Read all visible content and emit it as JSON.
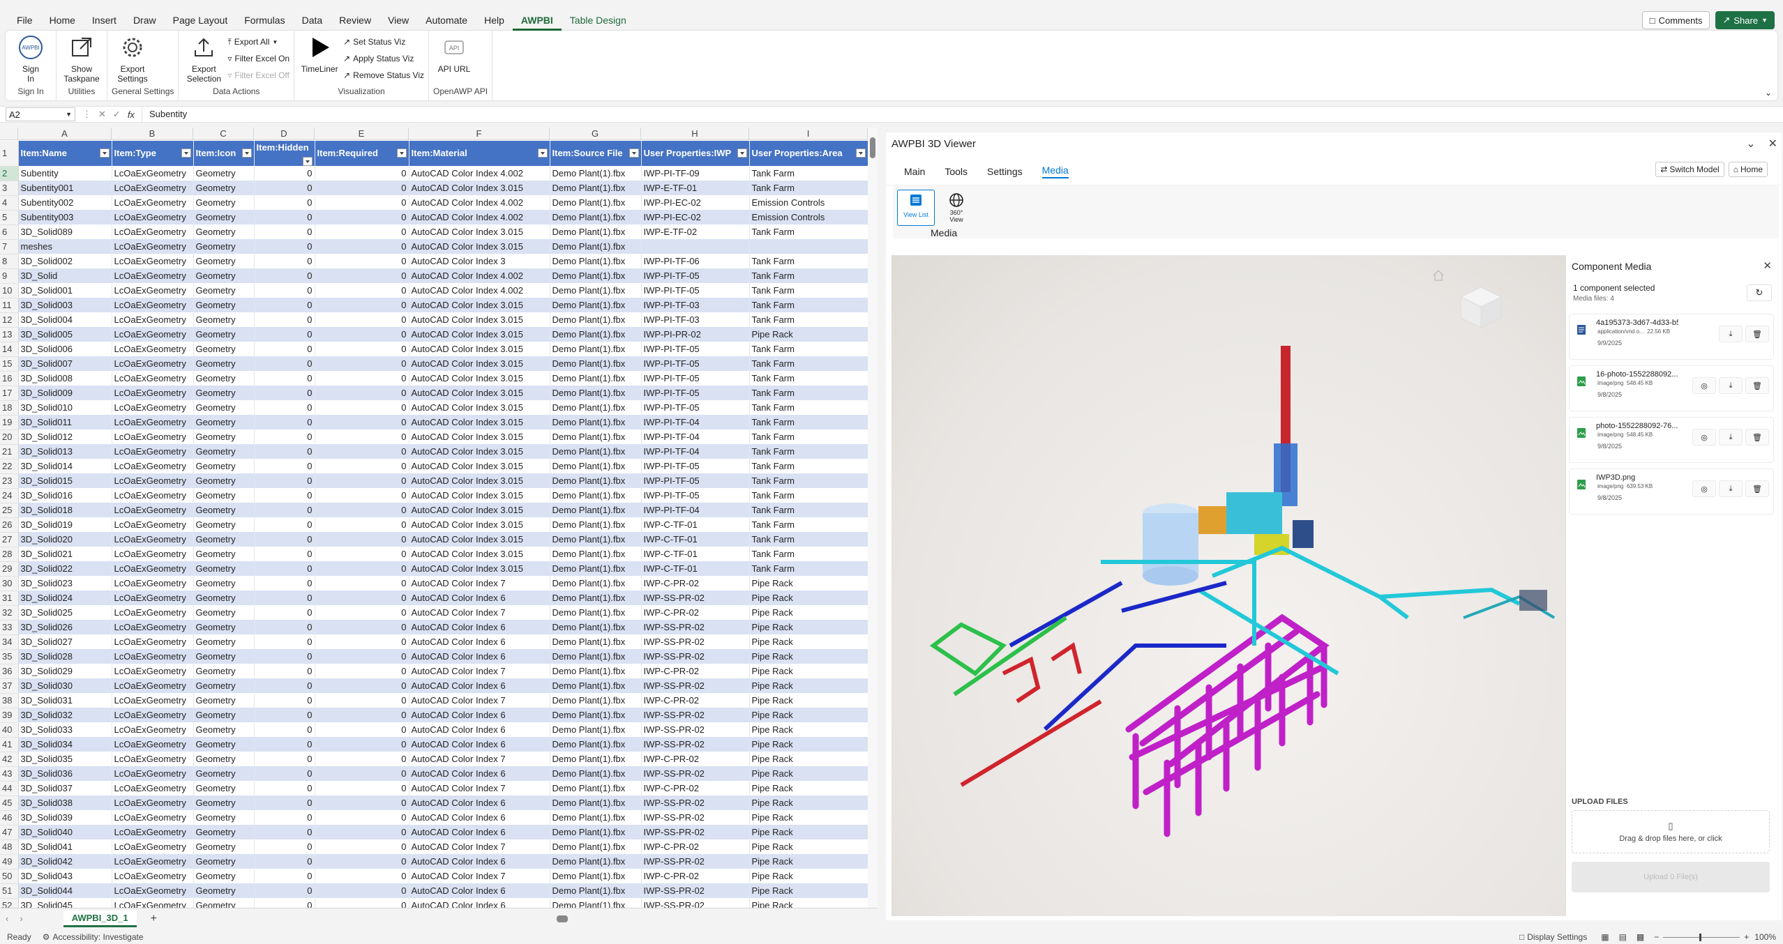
{
  "menu": [
    "File",
    "Home",
    "Insert",
    "Draw",
    "Page Layout",
    "Formulas",
    "Data",
    "Review",
    "View",
    "Automate",
    "Help",
    "AWPBI",
    "Table Design"
  ],
  "menu_active": "AWPBI",
  "top_buttons": {
    "comments": "Comments",
    "share": "Share"
  },
  "ribbon": {
    "sign_in": {
      "label1": "Sign",
      "label2": "In",
      "group": "Sign In",
      "icon_text": "AWPBI"
    },
    "show_taskpane": {
      "label1": "Show",
      "label2": "Taskpane",
      "group": "Utilities"
    },
    "export_settings": {
      "label1": "Export",
      "label2": "Settings",
      "group": "General Settings"
    },
    "export_selection": {
      "label1": "Export",
      "label2": "Selection"
    },
    "export_all": "Export All",
    "filter_on": "Filter Excel On",
    "filter_off": "Filter Excel Off",
    "data_group": "Data Actions",
    "timeliner": "TimeLiner",
    "set_status": "Set Status Viz",
    "apply_status": "Apply Status Viz",
    "remove_status": "Remove Status Viz",
    "viz_group": "Visualization",
    "api_url": "API URL",
    "api_group": "OpenAWP API",
    "api_icon_text": "API"
  },
  "formula_bar": {
    "cell": "A2",
    "fx": "fx",
    "value": "Subentity"
  },
  "columns": [
    "A",
    "B",
    "C",
    "D",
    "E",
    "F",
    "G",
    "H",
    "I"
  ],
  "headers": [
    "Item:Name",
    "Item:Type",
    "Item:Icon",
    "Item:Hidden",
    "Item:Required",
    "Item:Material",
    "Item:Source File",
    "User Properties:IWP",
    "User Properties:Area"
  ],
  "rows": [
    [
      "Subentity",
      "LcOaExGeometry",
      "Geometry",
      "0",
      "0",
      "AutoCAD Color Index 4.002",
      "Demo Plant(1).fbx",
      "IWP-PI-TF-09",
      "Tank Farm"
    ],
    [
      "Subentity001",
      "LcOaExGeometry",
      "Geometry",
      "0",
      "0",
      "AutoCAD Color Index 3.015",
      "Demo Plant(1).fbx",
      "IWP-E-TF-01",
      "Tank Farm"
    ],
    [
      "Subentity002",
      "LcOaExGeometry",
      "Geometry",
      "0",
      "0",
      "AutoCAD Color Index 4.002",
      "Demo Plant(1).fbx",
      "IWP-PI-EC-02",
      "Emission Controls"
    ],
    [
      "Subentity003",
      "LcOaExGeometry",
      "Geometry",
      "0",
      "0",
      "AutoCAD Color Index 4.002",
      "Demo Plant(1).fbx",
      "IWP-PI-EC-02",
      "Emission Controls"
    ],
    [
      "3D_Solid089",
      "LcOaExGeometry",
      "Geometry",
      "0",
      "0",
      "AutoCAD Color Index 3.015",
      "Demo Plant(1).fbx",
      "IWP-E-TF-02",
      "Tank Farm"
    ],
    [
      "meshes",
      "LcOaExGeometry",
      "Geometry",
      "0",
      "0",
      "AutoCAD Color Index 3.015",
      "Demo Plant(1).fbx",
      "",
      ""
    ],
    [
      "3D_Solid002",
      "LcOaExGeometry",
      "Geometry",
      "0",
      "0",
      "AutoCAD Color Index 3",
      "Demo Plant(1).fbx",
      "IWP-PI-TF-06",
      "Tank Farm"
    ],
    [
      "3D_Solid",
      "LcOaExGeometry",
      "Geometry",
      "0",
      "0",
      "AutoCAD Color Index 4.002",
      "Demo Plant(1).fbx",
      "IWP-PI-TF-05",
      "Tank Farm"
    ],
    [
      "3D_Solid001",
      "LcOaExGeometry",
      "Geometry",
      "0",
      "0",
      "AutoCAD Color Index 4.002",
      "Demo Plant(1).fbx",
      "IWP-PI-TF-05",
      "Tank Farm"
    ],
    [
      "3D_Solid003",
      "LcOaExGeometry",
      "Geometry",
      "0",
      "0",
      "AutoCAD Color Index 3.015",
      "Demo Plant(1).fbx",
      "IWP-PI-TF-03",
      "Tank Farm"
    ],
    [
      "3D_Solid004",
      "LcOaExGeometry",
      "Geometry",
      "0",
      "0",
      "AutoCAD Color Index 3.015",
      "Demo Plant(1).fbx",
      "IWP-PI-TF-03",
      "Tank Farm"
    ],
    [
      "3D_Solid005",
      "LcOaExGeometry",
      "Geometry",
      "0",
      "0",
      "AutoCAD Color Index 3.015",
      "Demo Plant(1).fbx",
      "IWP-PI-PR-02",
      "Pipe Rack"
    ],
    [
      "3D_Solid006",
      "LcOaExGeometry",
      "Geometry",
      "0",
      "0",
      "AutoCAD Color Index 3.015",
      "Demo Plant(1).fbx",
      "IWP-PI-TF-05",
      "Tank Farm"
    ],
    [
      "3D_Solid007",
      "LcOaExGeometry",
      "Geometry",
      "0",
      "0",
      "AutoCAD Color Index 3.015",
      "Demo Plant(1).fbx",
      "IWP-PI-TF-05",
      "Tank Farm"
    ],
    [
      "3D_Solid008",
      "LcOaExGeometry",
      "Geometry",
      "0",
      "0",
      "AutoCAD Color Index 3.015",
      "Demo Plant(1).fbx",
      "IWP-PI-TF-05",
      "Tank Farm"
    ],
    [
      "3D_Solid009",
      "LcOaExGeometry",
      "Geometry",
      "0",
      "0",
      "AutoCAD Color Index 3.015",
      "Demo Plant(1).fbx",
      "IWP-PI-TF-05",
      "Tank Farm"
    ],
    [
      "3D_Solid010",
      "LcOaExGeometry",
      "Geometry",
      "0",
      "0",
      "AutoCAD Color Index 3.015",
      "Demo Plant(1).fbx",
      "IWP-PI-TF-05",
      "Tank Farm"
    ],
    [
      "3D_Solid011",
      "LcOaExGeometry",
      "Geometry",
      "0",
      "0",
      "AutoCAD Color Index 3.015",
      "Demo Plant(1).fbx",
      "IWP-PI-TF-04",
      "Tank Farm"
    ],
    [
      "3D_Solid012",
      "LcOaExGeometry",
      "Geometry",
      "0",
      "0",
      "AutoCAD Color Index 3.015",
      "Demo Plant(1).fbx",
      "IWP-PI-TF-04",
      "Tank Farm"
    ],
    [
      "3D_Solid013",
      "LcOaExGeometry",
      "Geometry",
      "0",
      "0",
      "AutoCAD Color Index 3.015",
      "Demo Plant(1).fbx",
      "IWP-PI-TF-04",
      "Tank Farm"
    ],
    [
      "3D_Solid014",
      "LcOaExGeometry",
      "Geometry",
      "0",
      "0",
      "AutoCAD Color Index 3.015",
      "Demo Plant(1).fbx",
      "IWP-PI-TF-05",
      "Tank Farm"
    ],
    [
      "3D_Solid015",
      "LcOaExGeometry",
      "Geometry",
      "0",
      "0",
      "AutoCAD Color Index 3.015",
      "Demo Plant(1).fbx",
      "IWP-PI-TF-05",
      "Tank Farm"
    ],
    [
      "3D_Solid016",
      "LcOaExGeometry",
      "Geometry",
      "0",
      "0",
      "AutoCAD Color Index 3.015",
      "Demo Plant(1).fbx",
      "IWP-PI-TF-05",
      "Tank Farm"
    ],
    [
      "3D_Solid018",
      "LcOaExGeometry",
      "Geometry",
      "0",
      "0",
      "AutoCAD Color Index 3.015",
      "Demo Plant(1).fbx",
      "IWP-PI-TF-04",
      "Tank Farm"
    ],
    [
      "3D_Solid019",
      "LcOaExGeometry",
      "Geometry",
      "0",
      "0",
      "AutoCAD Color Index 3.015",
      "Demo Plant(1).fbx",
      "IWP-C-TF-01",
      "Tank Farm"
    ],
    [
      "3D_Solid020",
      "LcOaExGeometry",
      "Geometry",
      "0",
      "0",
      "AutoCAD Color Index 3.015",
      "Demo Plant(1).fbx",
      "IWP-C-TF-01",
      "Tank Farm"
    ],
    [
      "3D_Solid021",
      "LcOaExGeometry",
      "Geometry",
      "0",
      "0",
      "AutoCAD Color Index 3.015",
      "Demo Plant(1).fbx",
      "IWP-C-TF-01",
      "Tank Farm"
    ],
    [
      "3D_Solid022",
      "LcOaExGeometry",
      "Geometry",
      "0",
      "0",
      "AutoCAD Color Index 3.015",
      "Demo Plant(1).fbx",
      "IWP-C-TF-01",
      "Tank Farm"
    ],
    [
      "3D_Solid023",
      "LcOaExGeometry",
      "Geometry",
      "0",
      "0",
      "AutoCAD Color Index 7",
      "Demo Plant(1).fbx",
      "IWP-C-PR-02",
      "Pipe Rack"
    ],
    [
      "3D_Solid024",
      "LcOaExGeometry",
      "Geometry",
      "0",
      "0",
      "AutoCAD Color Index 6",
      "Demo Plant(1).fbx",
      "IWP-SS-PR-02",
      "Pipe Rack"
    ],
    [
      "3D_Solid025",
      "LcOaExGeometry",
      "Geometry",
      "0",
      "0",
      "AutoCAD Color Index 7",
      "Demo Plant(1).fbx",
      "IWP-C-PR-02",
      "Pipe Rack"
    ],
    [
      "3D_Solid026",
      "LcOaExGeometry",
      "Geometry",
      "0",
      "0",
      "AutoCAD Color Index 6",
      "Demo Plant(1).fbx",
      "IWP-SS-PR-02",
      "Pipe Rack"
    ],
    [
      "3D_Solid027",
      "LcOaExGeometry",
      "Geometry",
      "0",
      "0",
      "AutoCAD Color Index 6",
      "Demo Plant(1).fbx",
      "IWP-SS-PR-02",
      "Pipe Rack"
    ],
    [
      "3D_Solid028",
      "LcOaExGeometry",
      "Geometry",
      "0",
      "0",
      "AutoCAD Color Index 6",
      "Demo Plant(1).fbx",
      "IWP-SS-PR-02",
      "Pipe Rack"
    ],
    [
      "3D_Solid029",
      "LcOaExGeometry",
      "Geometry",
      "0",
      "0",
      "AutoCAD Color Index 7",
      "Demo Plant(1).fbx",
      "IWP-C-PR-02",
      "Pipe Rack"
    ],
    [
      "3D_Solid030",
      "LcOaExGeometry",
      "Geometry",
      "0",
      "0",
      "AutoCAD Color Index 6",
      "Demo Plant(1).fbx",
      "IWP-SS-PR-02",
      "Pipe Rack"
    ],
    [
      "3D_Solid031",
      "LcOaExGeometry",
      "Geometry",
      "0",
      "0",
      "AutoCAD Color Index 7",
      "Demo Plant(1).fbx",
      "IWP-C-PR-02",
      "Pipe Rack"
    ],
    [
      "3D_Solid032",
      "LcOaExGeometry",
      "Geometry",
      "0",
      "0",
      "AutoCAD Color Index 6",
      "Demo Plant(1).fbx",
      "IWP-SS-PR-02",
      "Pipe Rack"
    ],
    [
      "3D_Solid033",
      "LcOaExGeometry",
      "Geometry",
      "0",
      "0",
      "AutoCAD Color Index 6",
      "Demo Plant(1).fbx",
      "IWP-SS-PR-02",
      "Pipe Rack"
    ],
    [
      "3D_Solid034",
      "LcOaExGeometry",
      "Geometry",
      "0",
      "0",
      "AutoCAD Color Index 6",
      "Demo Plant(1).fbx",
      "IWP-SS-PR-02",
      "Pipe Rack"
    ],
    [
      "3D_Solid035",
      "LcOaExGeometry",
      "Geometry",
      "0",
      "0",
      "AutoCAD Color Index 7",
      "Demo Plant(1).fbx",
      "IWP-C-PR-02",
      "Pipe Rack"
    ],
    [
      "3D_Solid036",
      "LcOaExGeometry",
      "Geometry",
      "0",
      "0",
      "AutoCAD Color Index 6",
      "Demo Plant(1).fbx",
      "IWP-SS-PR-02",
      "Pipe Rack"
    ],
    [
      "3D_Solid037",
      "LcOaExGeometry",
      "Geometry",
      "0",
      "0",
      "AutoCAD Color Index 7",
      "Demo Plant(1).fbx",
      "IWP-C-PR-02",
      "Pipe Rack"
    ],
    [
      "3D_Solid038",
      "LcOaExGeometry",
      "Geometry",
      "0",
      "0",
      "AutoCAD Color Index 6",
      "Demo Plant(1).fbx",
      "IWP-SS-PR-02",
      "Pipe Rack"
    ],
    [
      "3D_Solid039",
      "LcOaExGeometry",
      "Geometry",
      "0",
      "0",
      "AutoCAD Color Index 6",
      "Demo Plant(1).fbx",
      "IWP-SS-PR-02",
      "Pipe Rack"
    ],
    [
      "3D_Solid040",
      "LcOaExGeometry",
      "Geometry",
      "0",
      "0",
      "AutoCAD Color Index 6",
      "Demo Plant(1).fbx",
      "IWP-SS-PR-02",
      "Pipe Rack"
    ],
    [
      "3D_Solid041",
      "LcOaExGeometry",
      "Geometry",
      "0",
      "0",
      "AutoCAD Color Index 7",
      "Demo Plant(1).fbx",
      "IWP-C-PR-02",
      "Pipe Rack"
    ],
    [
      "3D_Solid042",
      "LcOaExGeometry",
      "Geometry",
      "0",
      "0",
      "AutoCAD Color Index 6",
      "Demo Plant(1).fbx",
      "IWP-SS-PR-02",
      "Pipe Rack"
    ],
    [
      "3D_Solid043",
      "LcOaExGeometry",
      "Geometry",
      "0",
      "0",
      "AutoCAD Color Index 7",
      "Demo Plant(1).fbx",
      "IWP-C-PR-02",
      "Pipe Rack"
    ],
    [
      "3D_Solid044",
      "LcOaExGeometry",
      "Geometry",
      "0",
      "0",
      "AutoCAD Color Index 6",
      "Demo Plant(1).fbx",
      "IWP-SS-PR-02",
      "Pipe Rack"
    ],
    [
      "3D_Solid045",
      "LcOaExGeometry",
      "Geometry",
      "0",
      "0",
      "AutoCAD Color Index 6",
      "Demo Plant(1).fbx",
      "IWP-SS-PR-02",
      "Pipe Rack"
    ]
  ],
  "sheet_tab": "AWPBI_3D_1",
  "status": {
    "ready": "Ready",
    "accessibility": "Accessibility: Investigate",
    "display_settings": "Display Settings",
    "zoom": "100%"
  },
  "viewer": {
    "title": "AWPBI 3D Viewer",
    "tabs": [
      "Main",
      "Tools",
      "Settings",
      "Media"
    ],
    "active_tab": "Media",
    "switch_model": "Switch Model",
    "home": "Home",
    "view_list": "View List",
    "view_360a": "360°",
    "view_360b": "View",
    "media_group": "Media"
  },
  "component_media": {
    "title": "Component Media",
    "selected": "1 component selected",
    "media_files": "Media files: 4",
    "items": [
      {
        "name": "4a195373-3d67-4d33-b55f-2b...",
        "type": "application/vnd.o...",
        "size": "22.56 KB",
        "date": "9/9/2025",
        "icon": "document-icon"
      },
      {
        "name": "16-photo-1552288092...",
        "type": "image/png",
        "size": "548.45 KB",
        "date": "9/8/2025",
        "icon": "image-icon"
      },
      {
        "name": "photo-1552288092-76...",
        "type": "image/png",
        "size": "548.45 KB",
        "date": "9/8/2025",
        "icon": "image-icon"
      },
      {
        "name": "IWP3D.png",
        "type": "image/png",
        "size": "639.53 KB",
        "date": "9/8/2025",
        "icon": "image-icon"
      }
    ],
    "upload_label": "UPLOAD FILES",
    "drop_text": "Drag & drop files here, or click",
    "upload_button": "Upload 0 File(s)"
  },
  "colors": {
    "accent": "#1e7145",
    "header_blue": "#4472c4",
    "band": "#d9e1f2",
    "viewer_accent": "#0078d4"
  }
}
